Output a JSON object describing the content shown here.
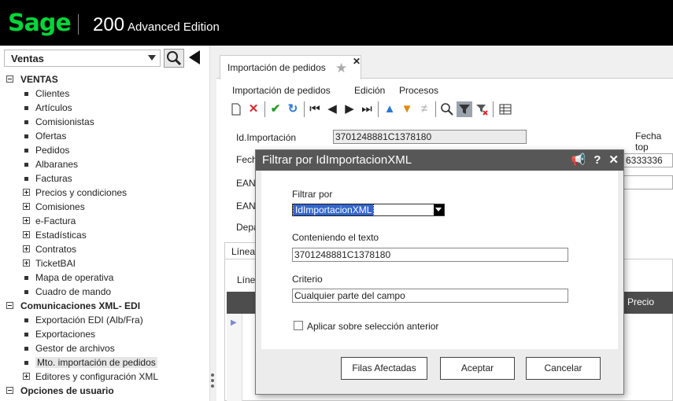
{
  "header": {
    "logo": "Sage",
    "product": "200",
    "edition": "Advanced Edition"
  },
  "sidebar": {
    "module": "Ventas",
    "items": [
      {
        "label": "VENTAS",
        "kind": "section",
        "icon": "minus"
      },
      {
        "label": "Clientes",
        "kind": "item",
        "icon": "bullet"
      },
      {
        "label": "Artículos",
        "kind": "item",
        "icon": "bullet"
      },
      {
        "label": "Comisionistas",
        "kind": "item",
        "icon": "bullet"
      },
      {
        "label": "Ofertas",
        "kind": "item",
        "icon": "bullet"
      },
      {
        "label": "Pedidos",
        "kind": "item",
        "icon": "bullet"
      },
      {
        "label": "Albaranes",
        "kind": "item",
        "icon": "bullet"
      },
      {
        "label": "Facturas",
        "kind": "item",
        "icon": "bullet"
      },
      {
        "label": "Precios y condiciones",
        "kind": "item",
        "icon": "plus"
      },
      {
        "label": "Comisiones",
        "kind": "item",
        "icon": "plus"
      },
      {
        "label": "e-Factura",
        "kind": "item",
        "icon": "plus"
      },
      {
        "label": "Estadísticas",
        "kind": "item",
        "icon": "plus"
      },
      {
        "label": "Contratos",
        "kind": "item",
        "icon": "plus"
      },
      {
        "label": "TicketBAI",
        "kind": "item",
        "icon": "plus"
      },
      {
        "label": "Mapa de operativa",
        "kind": "item",
        "icon": "bullet"
      },
      {
        "label": "Cuadro de mando",
        "kind": "item",
        "icon": "bullet"
      },
      {
        "label": "Comunicaciones XML- EDI",
        "kind": "section",
        "icon": "minus"
      },
      {
        "label": "Exportación EDI (Alb/Fra)",
        "kind": "item",
        "icon": "bullet"
      },
      {
        "label": "Exportaciones",
        "kind": "item",
        "icon": "bullet"
      },
      {
        "label": "Gestor de archivos",
        "kind": "item",
        "icon": "bullet"
      },
      {
        "label": "Mto. importación de pedidos",
        "kind": "item",
        "icon": "bullet",
        "selected": true
      },
      {
        "label": "Editores y configuración XML",
        "kind": "item",
        "icon": "plus"
      },
      {
        "label": "Opciones de usuario",
        "kind": "section",
        "icon": "minus"
      }
    ]
  },
  "main": {
    "tab_title": "Importación de pedidos",
    "menu": [
      "Importación de pedidos",
      "Edición",
      "Procesos"
    ],
    "form": {
      "id_label": "Id.Importación",
      "id_value": "3701248881C1378180",
      "fecha_top_label": "Fecha top",
      "fecha_label": "Fech",
      "ean1_label": "EAN",
      "ean2_label": "EAN",
      "dep_label": "Depa",
      "right_value": "6333336"
    },
    "subtab": "Línea",
    "grid": {
      "first_col_header": "Líne",
      "precio_header": "Precio"
    }
  },
  "dialog": {
    "title": "Filtrar por IdImportacionXML",
    "filtrar_label": "Filtrar por",
    "filtrar_value": "IdImportacionXML",
    "contiene_label": "Conteniendo el texto",
    "contiene_value": "3701248881C1378180",
    "criterio_label": "Criterio",
    "criterio_value": "Cualquier parte del campo",
    "check_label": "Aplicar sobre selección anterior",
    "check_checked": false,
    "buttons": {
      "filas": "Filas Afectadas",
      "aceptar": "Aceptar",
      "cancelar": "Cancelar"
    }
  }
}
